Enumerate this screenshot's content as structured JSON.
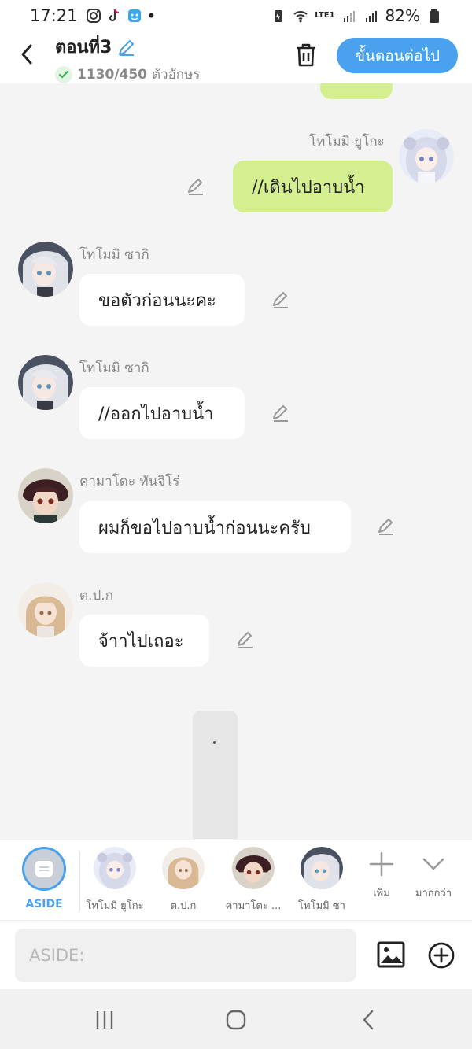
{
  "status_bar": {
    "time": "17:21",
    "battery": "82%",
    "network_label": "LTE1"
  },
  "header": {
    "title": "ตอนที่3",
    "char_count": "1130/450",
    "char_unit": "ตัวอักษร",
    "next_button": "ขั้นตอนต่อไป"
  },
  "messages": [
    {
      "speaker": "โทโมมิ ยูโกะ",
      "text": "//เดินไปอาบน้ำ",
      "side": "right"
    },
    {
      "speaker": "โทโมมิ ซากิ",
      "text": "ขอตัวก่อนนะคะ",
      "side": "left"
    },
    {
      "speaker": "โทโมมิ ซากิ",
      "text": "//ออกไปอาบน้ำ",
      "side": "left"
    },
    {
      "speaker": "คามาโดะ ทันจิโร่",
      "text": "ผมก็ขอไปอาบน้ำก่อนนะครับ",
      "side": "left"
    },
    {
      "speaker": "ต.ป.ก",
      "text": "จ้าาไปเถอะ",
      "side": "left"
    }
  ],
  "scroll_indicator": ".",
  "character_bar": {
    "aside_label": "ASIDE",
    "characters": [
      "โทโมมิ ยูโกะ",
      "ต.ป.ก",
      "คามาโดะ ...",
      "โทโมมิ ซา"
    ],
    "add_label": "เพิ่ม",
    "more_label": "มากกว่า"
  },
  "input": {
    "placeholder": "ASIDE:"
  },
  "colors": {
    "accent": "#4aa2ef",
    "bubble_self": "#d4ef8f",
    "bubble_other": "#ffffff",
    "background": "#f4f4f4"
  }
}
